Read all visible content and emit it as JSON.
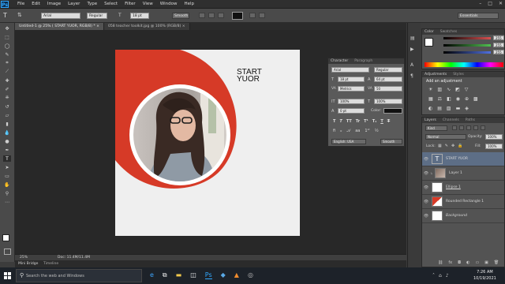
{
  "app": {
    "logo": "Ps"
  },
  "menu": [
    "File",
    "Edit",
    "Image",
    "Layer",
    "Type",
    "Select",
    "Filter",
    "View",
    "Window",
    "Help"
  ],
  "window_controls": [
    "–",
    "□",
    "✕"
  ],
  "options_bar": {
    "font": "Arial",
    "style": "Regular",
    "size": "18 pt",
    "antialias": "Smooth",
    "workspace": "Essentials"
  },
  "tabs": [
    {
      "label": "Untitled-1 @ 25% ( START YUOR, RGB/8) *  ×",
      "active": true
    },
    {
      "label": "058 teacher toolkit.jpg @ 100% (RGB/8)  ×",
      "active": false
    }
  ],
  "document": {
    "headline": [
      "START",
      "YUOR"
    ]
  },
  "status": {
    "zoom": "25%",
    "doc": "Doc: 11.4M/11.4M"
  },
  "bottom_tabs": [
    "Mini Bridge",
    "Timeline"
  ],
  "color_panel": {
    "tabs": [
      "Color",
      "Swatches"
    ],
    "values": [
      "255",
      "255",
      "255"
    ],
    "colors": {
      "r": "#d85050",
      "g": "#50c050",
      "b": "#5070e0"
    }
  },
  "adjustments_panel": {
    "tabs": [
      "Adjustments",
      "Styles"
    ],
    "title": "Add an adjustment"
  },
  "character_panel": {
    "tabs": [
      "Character",
      "Paragraph"
    ],
    "font": "Arial",
    "style": "Regular",
    "size": "18 pt",
    "leading": "64 pt",
    "kerning": "Metrics",
    "tracking": "50",
    "vscale": "100%",
    "hscale": "100%",
    "baseline": "0 pt",
    "color_label": "Color:",
    "language": "English: USA",
    "antialias": "Smooth"
  },
  "layers_panel": {
    "tabs": [
      "Layers",
      "Channels",
      "Paths"
    ],
    "kind": "Kind",
    "blend": "Normal",
    "opacity_label": "Opacity:",
    "opacity": "100%",
    "lock_label": "Lock:",
    "fill_label": "Fill:",
    "fill": "100%",
    "layers": [
      {
        "name": "START YUOR",
        "type": "text",
        "selected": true
      },
      {
        "name": "Layer 1",
        "type": "image",
        "selected": false
      },
      {
        "name": "Ellipse 1",
        "type": "shape",
        "selected": false
      },
      {
        "name": "Rounded Rectangle 1",
        "type": "shape",
        "selected": false
      },
      {
        "name": "Background",
        "type": "fill",
        "selected": false
      }
    ]
  },
  "taskbar": {
    "search_placeholder": "Search the web and Windows",
    "time": "7:26 AM",
    "date": "10/19/2021"
  },
  "colors": {
    "accent_red": "#d63a27",
    "doc_bg": "#efefef"
  }
}
